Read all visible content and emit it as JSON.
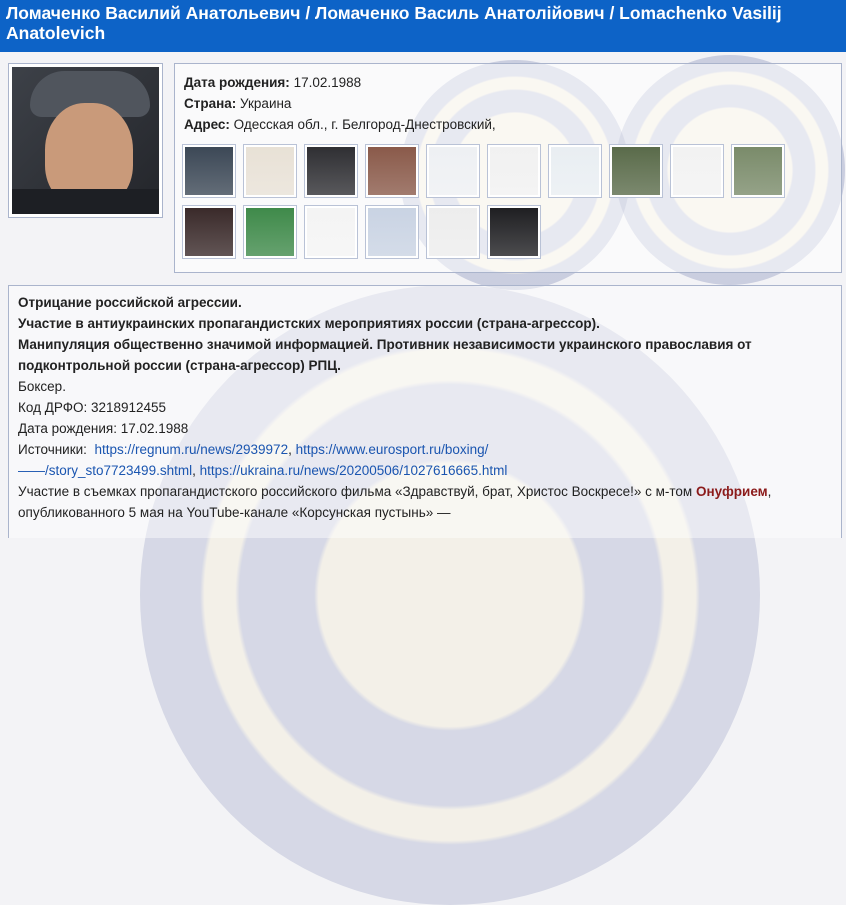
{
  "header": {
    "title_line1": "Ломаченко Василий Анатольевич / Ломаченко Василь Анатолійович / Lomachenko Vasilij",
    "title_line2": "Anatolevich"
  },
  "profile": {
    "birth_label": "Дата рождения:",
    "birth_value": "17.02.1988",
    "country_label": "Страна:",
    "country_value": "Украина",
    "address_label": "Адрес:",
    "address_value": "Одесская обл., г. Белгород-Днестровский,"
  },
  "evidence_thumbnails": [
    {
      "name": "thumb-1",
      "color": "#3c4856"
    },
    {
      "name": "thumb-2",
      "color": "#e8e1d6"
    },
    {
      "name": "thumb-3",
      "color": "#2f2f33"
    },
    {
      "name": "thumb-4",
      "color": "#8a5a4a"
    },
    {
      "name": "thumb-5",
      "color": "#eef0f3"
    },
    {
      "name": "thumb-6",
      "color": "#f1f1f1"
    },
    {
      "name": "thumb-7",
      "color": "#e9eef2"
    },
    {
      "name": "thumb-8",
      "color": "#5a6b4a"
    },
    {
      "name": "thumb-9",
      "color": "#f2f2f2"
    },
    {
      "name": "thumb-10",
      "color": "#7a8b6a"
    },
    {
      "name": "thumb-11",
      "color": "#3a2a2a"
    },
    {
      "name": "thumb-12",
      "color": "#3f8a4a"
    },
    {
      "name": "thumb-13",
      "color": "#f4f4f4"
    },
    {
      "name": "thumb-14",
      "color": "#c9d3e3"
    },
    {
      "name": "thumb-15",
      "color": "#ededed"
    },
    {
      "name": "thumb-16",
      "color": "#1f1f22"
    }
  ],
  "details": {
    "accusation_1": "Отрицание российской агрессии.",
    "accusation_2": "Участие в антиукраинских пропагандистских мероприятиях  россии (страна-агрессор).",
    "accusation_3a": "Манипуляция общественно значимой информацией. Противник независимости украинского православия от",
    "accusation_3b": "подконтрольной россии (страна-агрессор) РПЦ.",
    "occupation": "Боксер.",
    "tax_id": "Код ДРФО: 3218912455",
    "birth": "Дата рождения: 17.02.1988",
    "sources_label": "Источники:",
    "source_link_1": "https://regnum.ru/news/2939972",
    "source_sep_1": ", ",
    "source_link_2": "https://www.eurosport.ru/boxing/",
    "source_link_2b": "——/story_sto7723499.shtml",
    "source_sep_2": ", ",
    "source_link_3": "https://ukraina.ru/news/20200506/1027616665.html",
    "film_text_a": "Участие в съемках пропагандистского российского фильма  «Здравствуй, брат, Христос Воскресе!» с м-том",
    "film_name_highlight": "Онуфрием",
    "film_text_b": ",",
    "film_text_c": "опубликованного 5 мая на YouTube-канале «Корсунская пустынь» —"
  }
}
